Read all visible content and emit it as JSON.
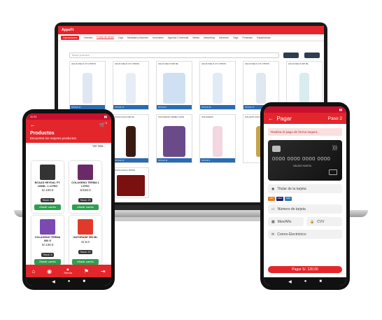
{
  "laptop": {
    "app_title": "AppeFt",
    "tabs": [
      "Operaciones",
      "Clientes",
      "Punto de venta",
      "Caja",
      "Medidas y fracción",
      "Inventario",
      "Agenda Comercial",
      "Metas",
      "Marketing",
      "Informes",
      "Tags",
      "Finanzas",
      "Estadísticas"
    ],
    "search_placeholder": "Buscar productos",
    "products": [
      {
        "name": "AGUA CIELO 2.5 LITROS",
        "footer": "STOCK 17"
      },
      {
        "name": "AGUA CIELO 2.5 LITROS",
        "footer": "STOCK 17"
      },
      {
        "name": "AGUA CIELO 625 ML",
        "footer": "STOCK 0"
      },
      {
        "name": "AGUA CIELO 2.5 LITROS",
        "footer": "STOCK 26"
      },
      {
        "name": "AGUA CIELO 2.5 LITROS",
        "footer": "STOCK 17"
      },
      {
        "name": "AGUA CIELO 625 ML",
        "footer": "STOCK 1"
      },
      {
        "name": "CAFE",
        "footer": "STOCK 17"
      },
      {
        "name": "COCA COLA 600 ML",
        "footer": "STOCK 17"
      },
      {
        "name": "COLAGENO TERMA CAFE",
        "footer": "STOCK 11"
      },
      {
        "name": "COLAGENO",
        "footer": "STOCK 9"
      },
      {
        "name": "GALLETA CON PECTINAL",
        "footer": ""
      },
      {
        "name": "CAMERA",
        "footer": ""
      },
      {
        "name": "GATORADE MANZ",
        "footer": ""
      },
      {
        "name": "COCA COLA LITROS",
        "footer": ""
      }
    ]
  },
  "left_phone": {
    "time": "11:51",
    "title": "Productos",
    "subtitle": "Encuentra los mejores productos.",
    "see_more": "Ver mas...",
    "products": [
      {
        "name": "BCAAS HEYDAL PT. 100ML. 1 LITRO",
        "price": "S/.100.0",
        "stock": "Stock: 21",
        "add": "Añadir carrito"
      },
      {
        "name": "COLAGENO TERMA 1 LITRO",
        "price": "S/150.0",
        "stock": "Stock: 29",
        "add": "Añadir carrito"
      },
      {
        "name": "COLAGENO TERMA 500 G",
        "price": "S/.130.0",
        "stock": "Stock: 8",
        "add": "Añadir carrito"
      },
      {
        "name": "GATORADE 500 ML",
        "price": "S/.5.0",
        "stock": "Stock: 23",
        "add": "Añadir carrito"
      }
    ],
    "nav_tienda": "Tienda",
    "cart_badge": "0"
  },
  "right_phone": {
    "title": "Pagar",
    "step": "Paso 2",
    "banner": "Realiza el pago de forma segura.",
    "card_number": "0000 0000 0000 0000",
    "valid_label": "VALIDO HASTA:",
    "fields": {
      "holder": "Titular de la tarjeta",
      "number": "Número de tarjeta",
      "month": "Mes/Año",
      "cvv": "CVV",
      "email": "Correo Electrónico"
    },
    "card_brands": [
      "VISA",
      "AMEX",
      "DISC"
    ],
    "pay_label": "Pagar S/. 120.00"
  },
  "colors": {
    "brand_red": "#e3262b",
    "add_green": "#2e9e4f",
    "product_blue": "#2b6cb0"
  }
}
